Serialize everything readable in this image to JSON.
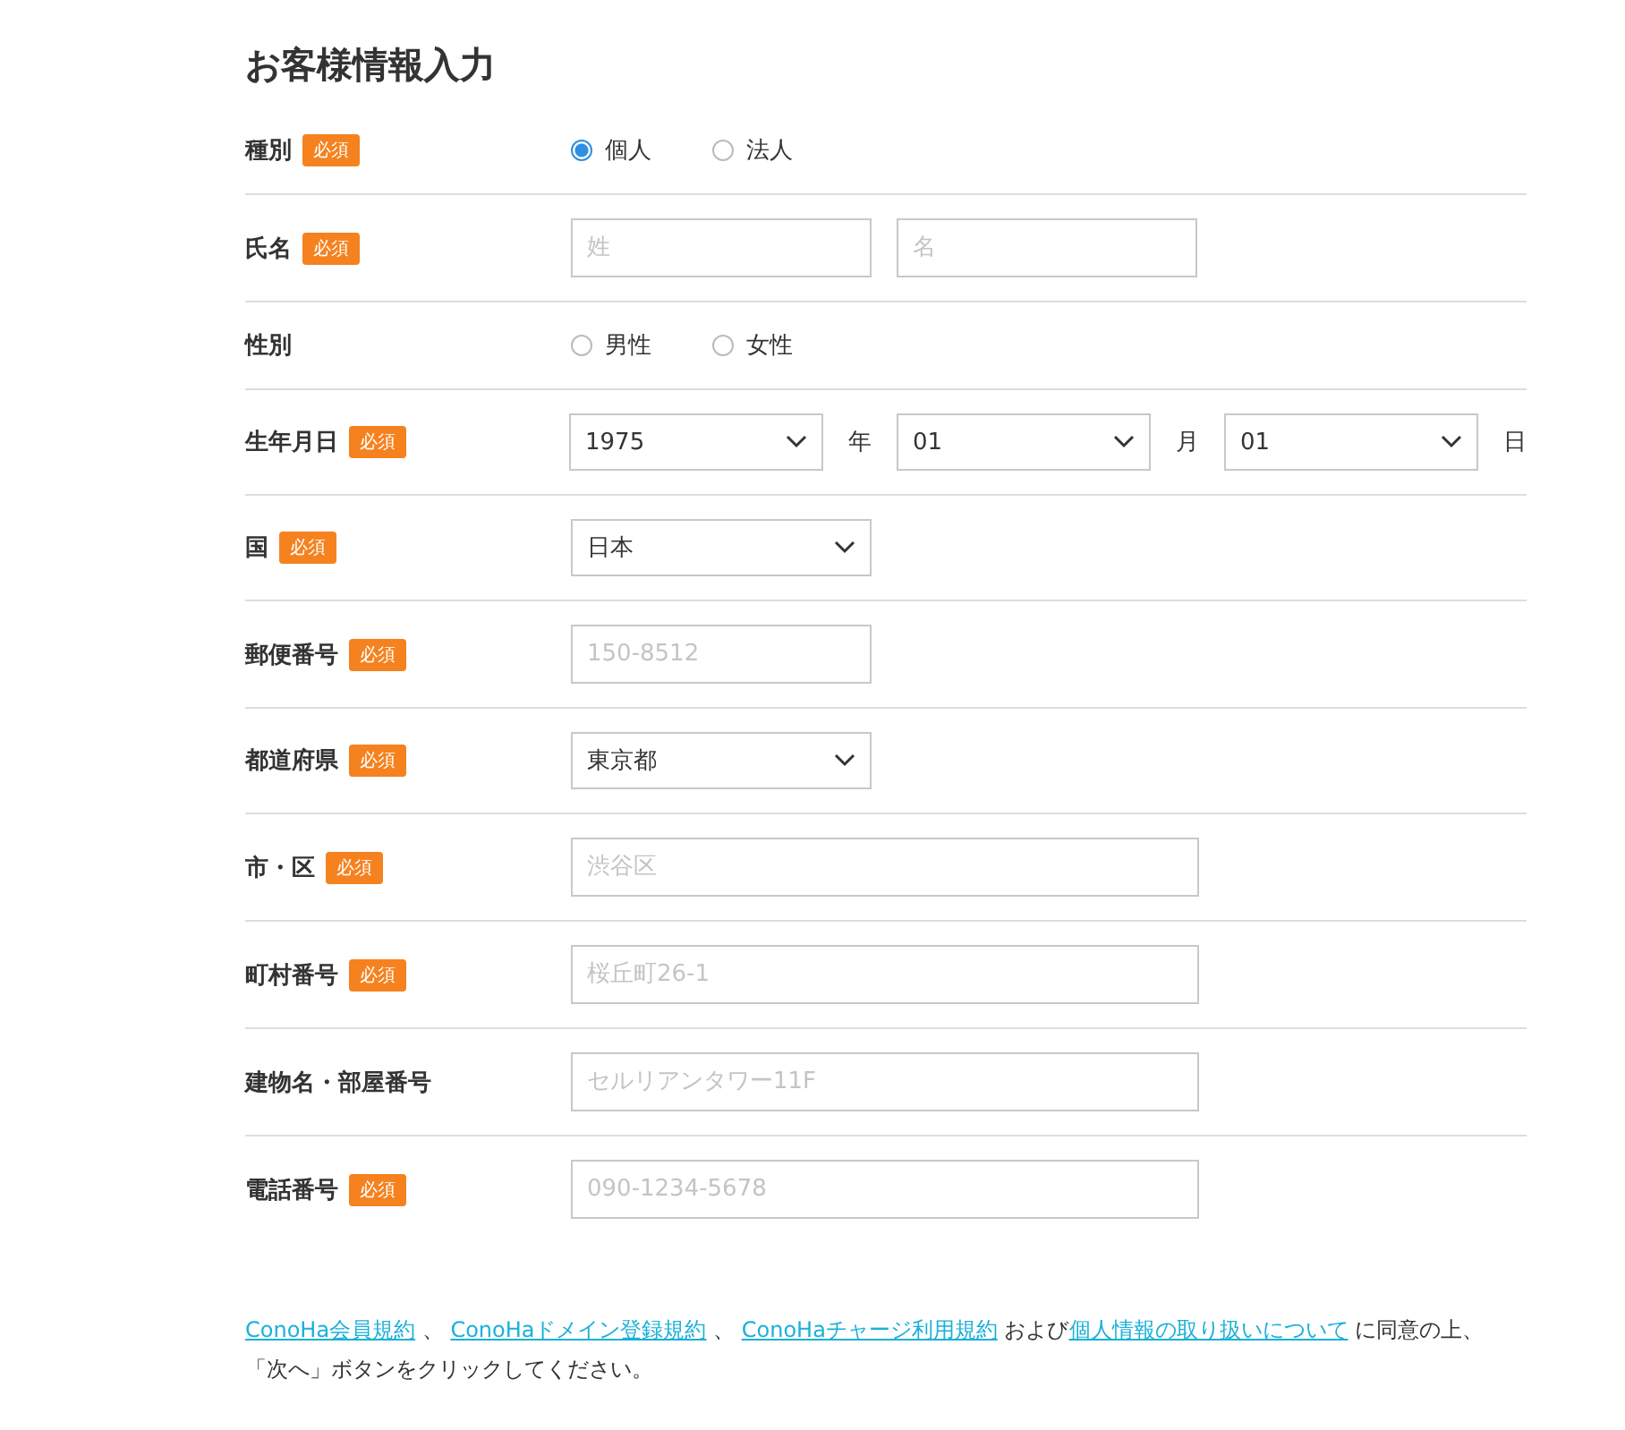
{
  "title": "お客様情報入力",
  "rows": [
    {
      "label": "種別",
      "required": "必須",
      "kind": "radio",
      "options": [
        {
          "label": "個人",
          "selected": true
        },
        {
          "label": "法人",
          "selected": false
        }
      ]
    },
    {
      "label": "氏名",
      "required": "必須",
      "kind": "text",
      "fields": [
        {
          "placeholder": "姓",
          "kind": "short"
        },
        {
          "placeholder": "名",
          "kind": "short"
        }
      ]
    },
    {
      "label": "性別",
      "kind": "radio",
      "options": [
        {
          "label": "男性",
          "selected": false
        },
        {
          "label": "女性",
          "selected": false
        }
      ]
    },
    {
      "label": "生年月日",
      "required": "必須",
      "kind": "select",
      "selects": [
        {
          "value": "1975",
          "unit": "年",
          "kind": "date"
        },
        {
          "value": "01",
          "unit": "月",
          "kind": "date"
        },
        {
          "value": "01",
          "unit": "日",
          "kind": "date"
        }
      ]
    },
    {
      "label": "国",
      "required": "必須",
      "kind": "select",
      "selects": [
        {
          "value": "日本",
          "kind": "short"
        }
      ]
    },
    {
      "label": "郵便番号",
      "required": "必須",
      "kind": "text",
      "fields": [
        {
          "placeholder": "150-8512",
          "kind": "short"
        }
      ]
    },
    {
      "label": "都道府県",
      "required": "必須",
      "kind": "select",
      "selects": [
        {
          "value": "東京都",
          "kind": "short"
        }
      ]
    },
    {
      "label": "市・区",
      "required": "必須",
      "kind": "text",
      "fields": [
        {
          "placeholder": "渋谷区",
          "kind": "long"
        }
      ]
    },
    {
      "label": "町村番号",
      "required": "必須",
      "kind": "text",
      "fields": [
        {
          "placeholder": "桜丘町26-1",
          "kind": "long"
        }
      ]
    },
    {
      "label": "建物名・部屋番号",
      "kind": "text",
      "fields": [
        {
          "placeholder": "セルリアンタワー11F",
          "kind": "long"
        }
      ]
    },
    {
      "label": "電話番号",
      "required": "必須",
      "kind": "text",
      "fields": [
        {
          "placeholder": "090-1234-5678",
          "kind": "long"
        }
      ]
    }
  ],
  "agreement": [
    {
      "text": "ConoHa会員規約",
      "link": true
    },
    {
      "text": " 、 ",
      "link": false
    },
    {
      "text": "ConoHaドメイン登録規約",
      "link": true
    },
    {
      "text": " 、 ",
      "link": false
    },
    {
      "text": "ConoHaチャージ利用規約",
      "link": true
    },
    {
      "text": " および",
      "link": false
    },
    {
      "text": "個人情報の取り扱いについて",
      "link": true
    },
    {
      "text": " に同意の上、「次へ」ボタンをクリックしてください。",
      "link": false
    }
  ]
}
